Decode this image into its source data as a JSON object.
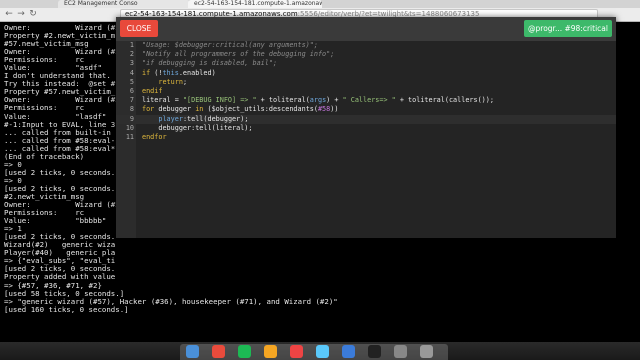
{
  "browser": {
    "tabs": [
      {
        "label": "EC2 Management Conso"
      },
      {
        "label": "ec2-54-163-154-181.compute-1.amazonaws.com"
      }
    ],
    "url_host": "ec2-54-163-154-181.compute-1.amazonaws.com",
    "url_rest": ":5556/editor/verb/?et=twilight&ts=1488060673135",
    "icons": [
      "back-icon",
      "forward-icon",
      "reload-icon",
      "home-icon"
    ]
  },
  "terminal": {
    "lines": [
      "Owner:          Wizard (#2)",
      "Property #2.newt_victim_m",
      "#57.newt_victim_msg",
      "Owner:          Wizard (#2)",
      "Permissions:    rc",
      "Value:          \"asdf\"",
      "I don't understand that.",
      "Try this instead:  @set #",
      "Property #57.newt_victim_",
      "Owner:          Wizard (#2)",
      "Permissions:    rc",
      "Value:          \"lasdf\"",
      "#-1:Input to EVAL, line 3",
      "... called from built-in",
      "... called from #58:eval-",
      "... called from #58:eval*",
      "(End of traceback)",
      "=> 0",
      "[used 2 ticks, 0 seconds.",
      "=> 0",
      "[used 2 ticks, 0 seconds.",
      "#2.newt_victim_msg",
      "Owner:          Wizard (#2)",
      "Permissions:    rc",
      "Value:          \"bbbbb\"",
      "=> 1",
      "[used 2 ticks, 0 seconds.",
      "Wizard(#2)   generic wiza",
      "Player(#40)   generic pla",
      "=> {\"eval_subs\", \"eval_ti",
      "[used 2 ticks, 0 seconds.",
      "Property added with value",
      "=> {#57, #36, #71, #2}",
      "[used 58 ticks, 0 seconds.]",
      "=> \"generic wizard (#57), Hacker (#36), housekeeper (#71), and Wizard (#2)\"",
      "[used 160 ticks, 0 seconds.]"
    ]
  },
  "modal": {
    "close_label": "CLOSE",
    "verb_label": "@progr... #98:critical",
    "lines": [
      {
        "n": "1",
        "tokens": [
          [
            "c-comment",
            "\"Usage: $debugger:critical(any arguments)\";"
          ]
        ]
      },
      {
        "n": "2",
        "tokens": [
          [
            "c-comment",
            "\"Notify all programmers of the debugging info\";"
          ]
        ]
      },
      {
        "n": "3",
        "tokens": [
          [
            "c-comment",
            "\"if debugging is disabled, bail\";"
          ]
        ]
      },
      {
        "n": "4",
        "tokens": [
          [
            "c-kw",
            "if"
          ],
          [
            "c-plain",
            " (!"
          ],
          [
            "c-var",
            "this"
          ],
          [
            "c-plain",
            ".enabled)"
          ]
        ]
      },
      {
        "n": "5",
        "tokens": [
          [
            "c-plain",
            "    "
          ],
          [
            "c-kw",
            "return"
          ],
          [
            "c-plain",
            ";"
          ]
        ]
      },
      {
        "n": "6",
        "tokens": [
          [
            "c-kw",
            "endif"
          ]
        ]
      },
      {
        "n": "7",
        "tokens": [
          [
            "c-plain",
            "literal = "
          ],
          [
            "c-str",
            "\"[DEBUG INFO] => \""
          ],
          [
            "c-plain",
            " + toliteral("
          ],
          [
            "c-var",
            "args"
          ],
          [
            "c-plain",
            ") + "
          ],
          [
            "c-str",
            "\" Callers=> \""
          ],
          [
            "c-plain",
            " + toliteral(callers());"
          ]
        ]
      },
      {
        "n": "8",
        "tokens": [
          [
            "c-kw",
            "for"
          ],
          [
            "c-plain",
            " debugger "
          ],
          [
            "c-kw",
            "in"
          ],
          [
            "c-plain",
            " ($object_utils:descendants("
          ],
          [
            "c-num",
            "#58"
          ],
          [
            "c-plain",
            "))"
          ]
        ]
      },
      {
        "n": "9",
        "tokens": [
          [
            "c-plain",
            "    "
          ],
          [
            "c-var",
            "player"
          ],
          [
            "c-plain",
            ":tell(debugger);"
          ]
        ]
      },
      {
        "n": "10",
        "tokens": [
          [
            "c-plain",
            "    debugger:tell(literal);"
          ]
        ]
      },
      {
        "n": "11",
        "tokens": [
          [
            "c-kw",
            "endfor"
          ]
        ]
      }
    ],
    "active_line": 9
  },
  "dock": {
    "icons": [
      "finder-icon",
      "chrome-icon",
      "spotify-icon",
      "photos-icon",
      "calendar-icon",
      "messages-icon",
      "mail-icon",
      "terminal-icon",
      "settings-icon",
      "trash-icon"
    ]
  }
}
